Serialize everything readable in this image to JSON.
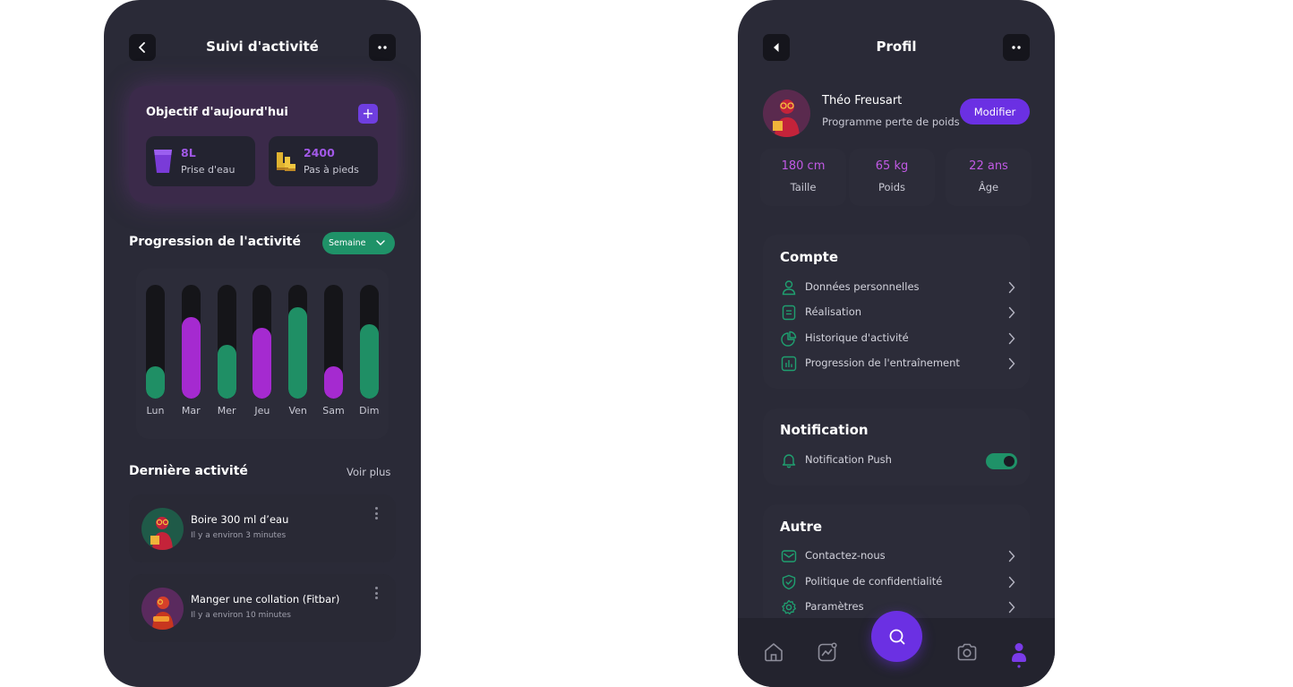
{
  "activity_screen": {
    "title": "Suivi d'activité",
    "goal": {
      "title": "Objectif d'aujourd'hui",
      "add_label": "+",
      "items": [
        {
          "value": "8L",
          "label": "Prise d'eau",
          "icon": "water-glass-icon"
        },
        {
          "value": "2400",
          "label": "Pas à pieds",
          "icon": "boots-icon"
        }
      ]
    },
    "progress": {
      "title": "Progression de l'activité",
      "period": "Semaine"
    },
    "chart_data": {
      "type": "bar",
      "categories": [
        "Lun",
        "Mar",
        "Mer",
        "Jeu",
        "Ven",
        "Sam",
        "Dim"
      ],
      "values": [
        0.28,
        0.72,
        0.47,
        0.62,
        0.8,
        0.28,
        0.65
      ],
      "ylim": [
        0,
        1
      ],
      "colors": [
        "#1f8f65",
        "#a52ad0",
        "#1f8f65",
        "#a52ad0",
        "#1f8f65",
        "#a52ad0",
        "#1f8f65"
      ],
      "xlabel": "",
      "ylabel": ""
    },
    "latest": {
      "title": "Dernière activité",
      "see_more": "Voir plus",
      "items": [
        {
          "title": "Boire 300 ml d’eau",
          "time": "Il y a environ 3 minutes"
        },
        {
          "title": "Manger une collation (Fitbar)",
          "time": "Il y a environ 10 minutes"
        }
      ]
    }
  },
  "profile_screen": {
    "title": "Profil",
    "user": {
      "name": "Théo Freusart",
      "program": "Programme perte de poids",
      "edit_label": "Modifier"
    },
    "stats": [
      {
        "value": "180 cm",
        "label": "Taille"
      },
      {
        "value": "65 kg",
        "label": "Poids"
      },
      {
        "value": "22 ans",
        "label": "Âge"
      }
    ],
    "account": {
      "title": "Compte",
      "items": [
        {
          "label": "Données personnelles",
          "icon": "user-icon"
        },
        {
          "label": "Réalisation",
          "icon": "document-icon"
        },
        {
          "label": "Historique d'activité",
          "icon": "pie-chart-icon"
        },
        {
          "label": "Progression de l'entraînement",
          "icon": "bar-chart-icon"
        }
      ]
    },
    "notification": {
      "title": "Notification",
      "push_label": "Notification Push",
      "push_enabled": true
    },
    "other": {
      "title": "Autre",
      "items": [
        {
          "label": "Contactez-nous",
          "icon": "mail-icon"
        },
        {
          "label": "Politique de confidentialité",
          "icon": "shield-icon"
        },
        {
          "label": "Paramètres",
          "icon": "settings-icon"
        }
      ]
    },
    "nav": [
      "home-icon",
      "activity-icon",
      "search-icon",
      "camera-icon",
      "profile-icon"
    ],
    "colors": {
      "accent": "#6b30e3",
      "green": "#1f9268",
      "purple": "#a52ad0",
      "background": "#2a2a37"
    }
  }
}
